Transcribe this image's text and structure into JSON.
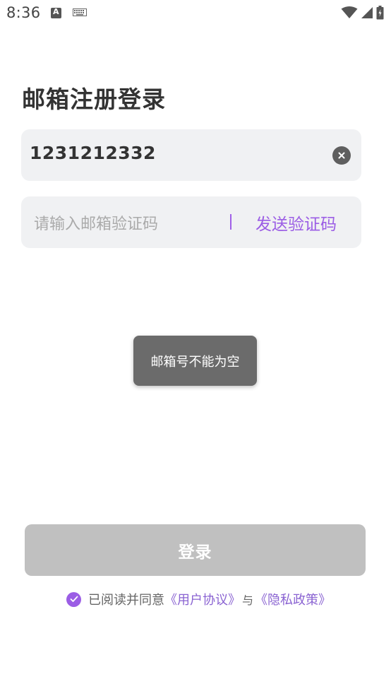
{
  "status_bar": {
    "time": "8:36",
    "icons": [
      "a-notification-icon",
      "keyboard-icon",
      "wifi-icon",
      "signal-icon",
      "battery-icon"
    ]
  },
  "title": "邮箱注册登录",
  "email_input": {
    "value": "1231212332",
    "clear_icon": "clear-icon"
  },
  "code_input": {
    "placeholder": "请输入邮箱验证码",
    "send_label": "发送验证码"
  },
  "toast": {
    "message": "邮箱号不能为空"
  },
  "login_button": {
    "label": "登录"
  },
  "agreement": {
    "checked": true,
    "prefix": "已阅读并同意",
    "user_agreement": "《用户协议》",
    "and": "与",
    "privacy_policy": "《隐私政策》"
  },
  "colors": {
    "accent": "#9b5de5",
    "field_bg": "#f0f1f3",
    "button_disabled": "#c0c0c0",
    "toast_bg": "#6b6b6b"
  }
}
